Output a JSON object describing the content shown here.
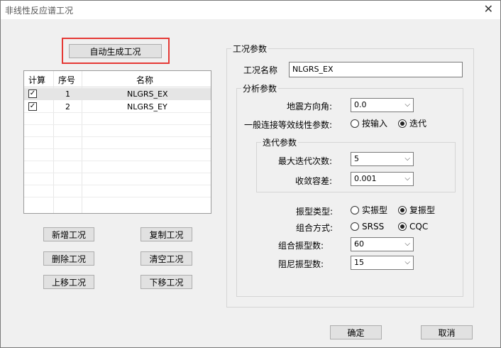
{
  "window": {
    "title": "非线性反应谱工况",
    "close_glyph": "✕"
  },
  "auto_button": "自动生成工况",
  "list": {
    "headers": [
      "计算",
      "序号",
      "名称"
    ],
    "rows": [
      {
        "checked": "✓",
        "index": "1",
        "name": "NLGRS_EX"
      },
      {
        "checked": "✓",
        "index": "2",
        "name": "NLGRS_EY"
      }
    ]
  },
  "buttons": {
    "add": "新增工况",
    "copy": "复制工况",
    "delete": "删除工况",
    "clear": "清空工况",
    "move_up": "上移工况",
    "move_down": "下移工况",
    "ok": "确定",
    "cancel": "取消"
  },
  "params": {
    "group_title": "工况参数",
    "case_name_label": "工况名称",
    "case_name_value": "NLGRS_EX",
    "analysis_title": "分析参数",
    "quake_dir_label": "地震方向角:",
    "quake_dir_value": "0.0",
    "link_label": "一般连接等效线性参数:",
    "link_opt1": "按输入",
    "link_opt2": "迭代",
    "iter_title": "迭代参数",
    "max_iter_label": "最大迭代次数:",
    "max_iter_value": "5",
    "tol_label": "收敛容差:",
    "tol_value": "0.001",
    "mode_type_label": "振型类型:",
    "mode_opt1": "实振型",
    "mode_opt2": "复振型",
    "combo_label": "组合方式:",
    "combo_opt1": "SRSS",
    "combo_opt2": "CQC",
    "combo_modes_label": "组合振型数:",
    "combo_modes_value": "60",
    "damp_modes_label": "阻尼振型数:",
    "damp_modes_value": "15"
  },
  "icons": {
    "chevron": "⌵"
  }
}
